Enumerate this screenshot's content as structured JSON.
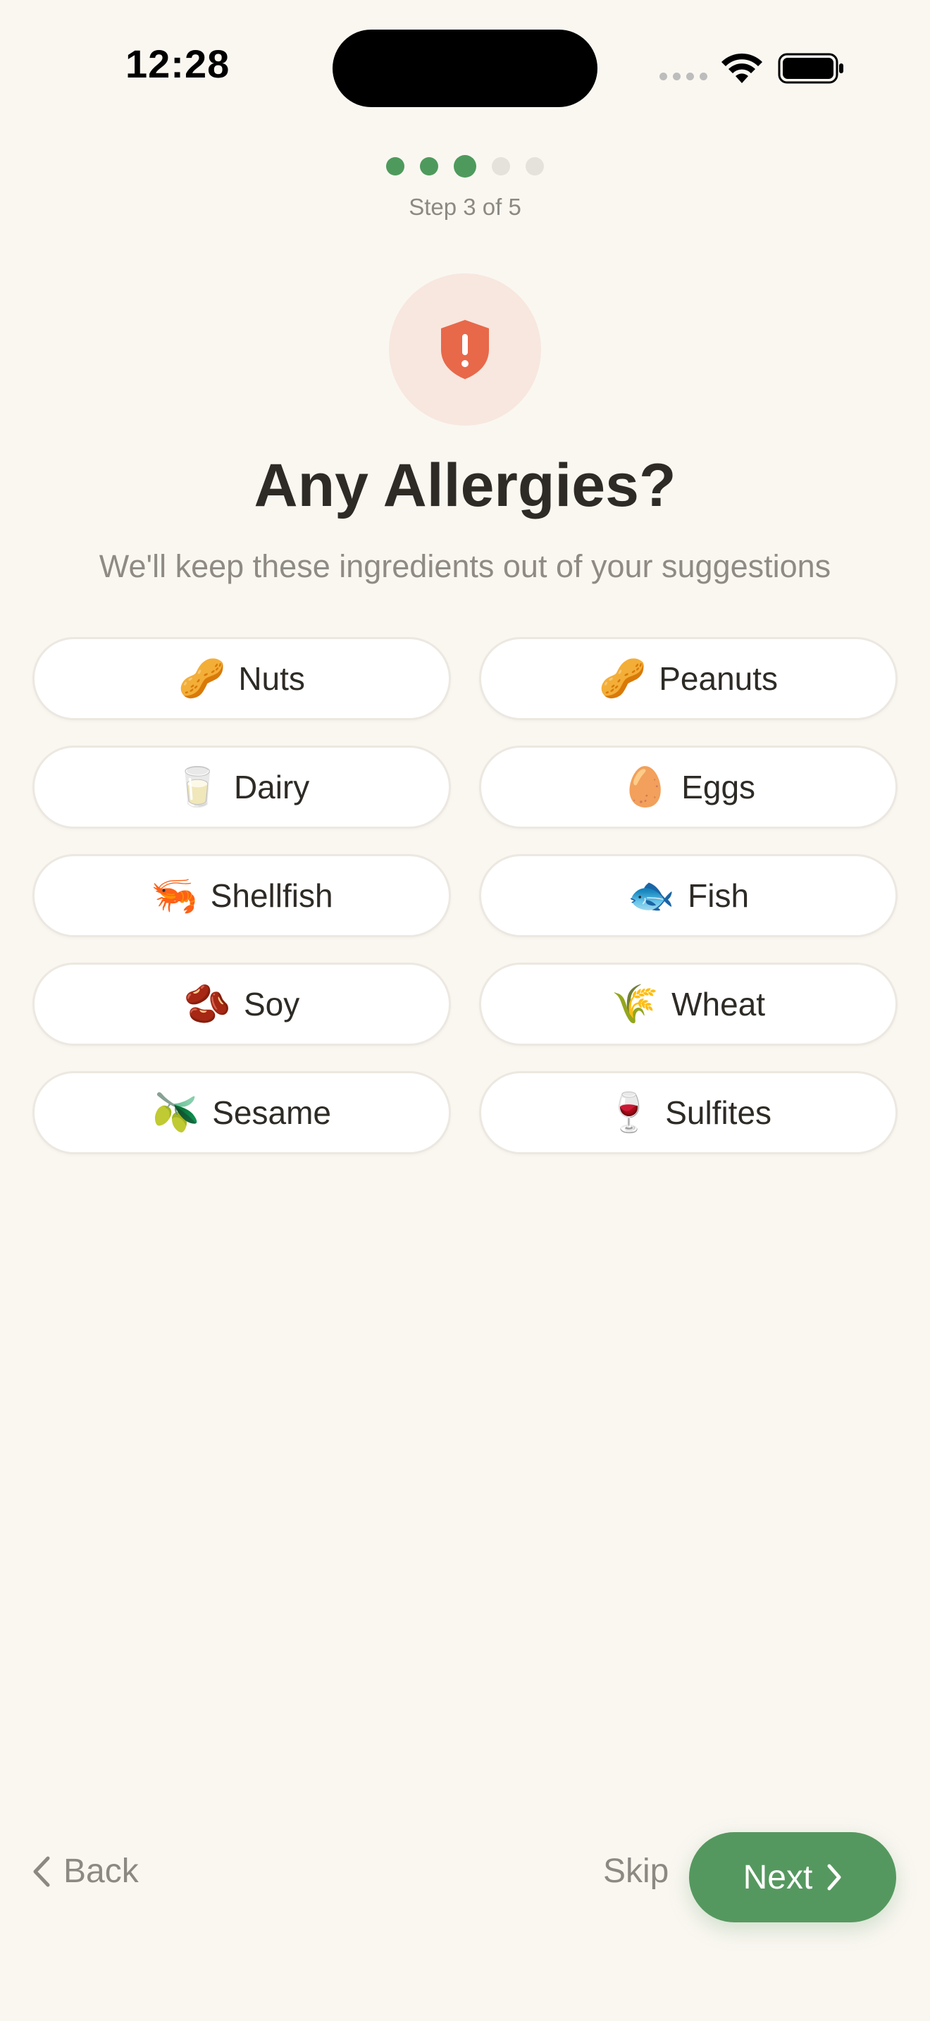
{
  "status_bar": {
    "time": "12:28"
  },
  "progress": {
    "total_steps": 5,
    "current_step": 3,
    "label": "Step 3 of 5",
    "active_color": "#4E9A5C",
    "inactive_color": "#E5E2DC"
  },
  "hero": {
    "icon": "shield-exclamation-icon",
    "icon_color": "#E8684A",
    "circle_color": "#F7E7DF"
  },
  "header": {
    "title": "Any Allergies?",
    "subtitle": "We'll keep these ingredients out of your suggestions"
  },
  "allergens": [
    {
      "emoji": "🥜",
      "label": "Nuts"
    },
    {
      "emoji": "🥜",
      "label": "Peanuts"
    },
    {
      "emoji": "🥛",
      "label": "Dairy"
    },
    {
      "emoji": "🥚",
      "label": "Eggs"
    },
    {
      "emoji": "🦐",
      "label": "Shellfish"
    },
    {
      "emoji": "🐟",
      "label": "Fish"
    },
    {
      "emoji": "🫘",
      "label": "Soy"
    },
    {
      "emoji": "🌾",
      "label": "Wheat"
    },
    {
      "emoji": "🫒",
      "label": "Sesame"
    },
    {
      "emoji": "🍷",
      "label": "Sulfites"
    }
  ],
  "nav": {
    "back_label": "Back",
    "skip_label": "Skip",
    "next_label": "Next",
    "next_color": "#55985F"
  }
}
